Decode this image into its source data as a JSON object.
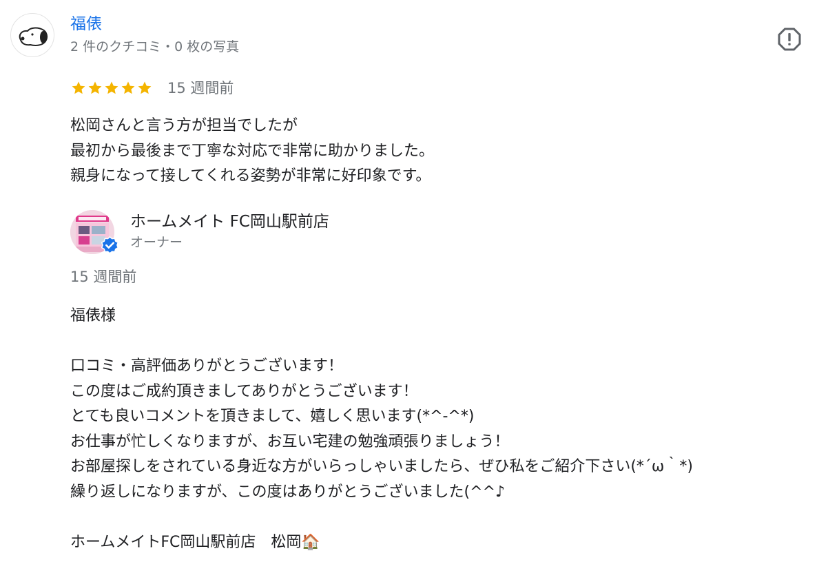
{
  "reviewer": {
    "name": "福俵",
    "meta": "2 件のクチコミ・0 枚の写真",
    "avatar_icon": "snoopy-avatar-icon"
  },
  "report": {
    "icon": "report-flag-icon"
  },
  "rating": {
    "stars": 5,
    "max_stars": 5,
    "star_color": "#f4b400",
    "time": "15 週間前"
  },
  "review": {
    "lines": [
      "松岡さんと言う方が担当でしたが",
      "最初から最後まで丁寧な対応で非常に助かりました。",
      "親身になって接してくれる姿勢が非常に好印象です。"
    ]
  },
  "owner": {
    "name": "ホームメイト FC岡山駅前店",
    "role": "オーナー",
    "reply_time": "15 週間前",
    "verified_color": "#1a73e8",
    "reply_lines": [
      "福俵様",
      "",
      "口コミ・高評価ありがとうございます！",
      "この度はご成約頂きましてありがとうございます！",
      "とても良いコメントを頂きまして、嬉しく思います(*^-^*)",
      "お仕事が忙しくなりますが、お互い宅建の勉強頑張りましょう！",
      "お部屋探しをされている身近な方がいらっしゃいましたら、ぜひ私をご紹介下さい(*´ω｀*)",
      "繰り返しになりますが、この度はありがとうございました(^^♪",
      "",
      "ホームメイトFC岡山駅前店　松岡🏠"
    ]
  }
}
